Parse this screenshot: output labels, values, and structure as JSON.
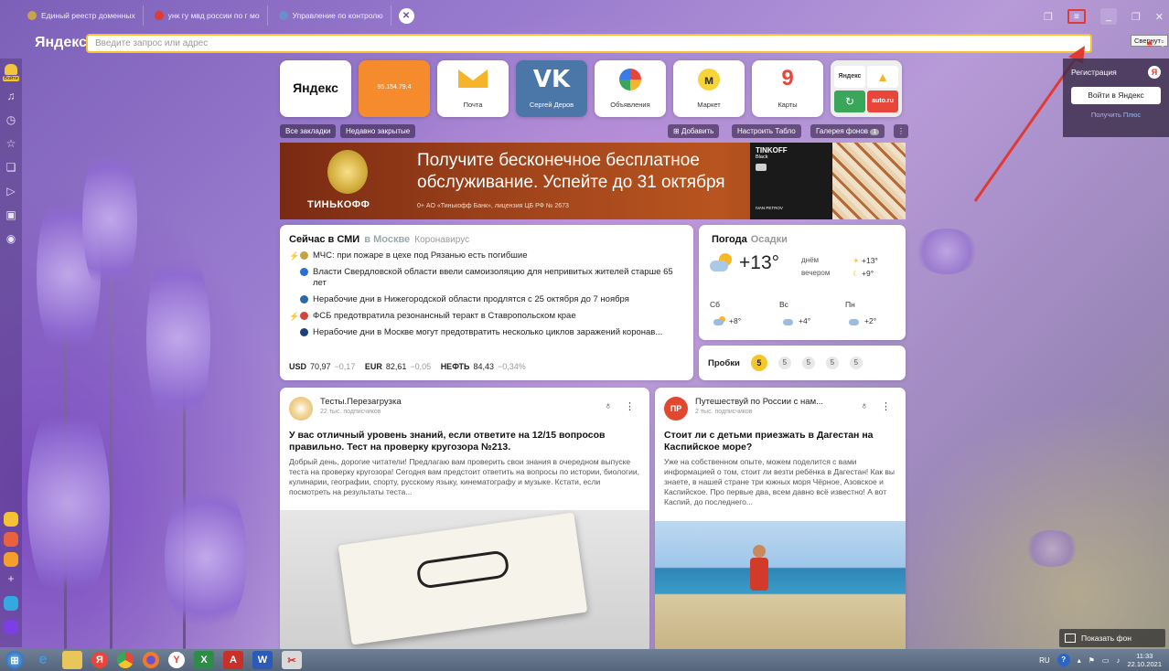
{
  "tabs": [
    {
      "label": "Единый реестр доменных",
      "color": "#c9a24a"
    },
    {
      "label": "унк гу мвд россии по г мо",
      "color": "#e03a33"
    },
    {
      "label": "Управление по контролю",
      "color": "#6a8fc9"
    }
  ],
  "window": {
    "tooltip": "Свернуть"
  },
  "addressbar": {
    "brand": "Яндекс",
    "placeholder": "Введите запрос или адрес"
  },
  "sidebar": {
    "login_label": "Войти"
  },
  "tiles": [
    {
      "label": "Яндекс"
    },
    {
      "label": "95.154.79.4"
    },
    {
      "label": "Почта"
    },
    {
      "label": "Сергей Деров"
    },
    {
      "label": "Объявления"
    },
    {
      "label": "Маркет"
    },
    {
      "label": "Карты"
    },
    {
      "label": "Яндекс",
      "label2": "auto.ru"
    }
  ],
  "bookmarks": {
    "all": "Все закладки",
    "recent": "Недавно закрытые",
    "add": "Добавить",
    "configure": "Настроить Табло",
    "gallery": "Галерея фонов",
    "gallery_count": "1"
  },
  "banner": {
    "text": "Получите бесконечное бесплатное обслуживание. Успейте до 31 октября",
    "logo": "ТИНЬКОФФ",
    "legal": "0+  АО «Тинькофф Банк», лицензия ЦБ РФ № 2673",
    "card_brand": "TINKOFF",
    "card_sub": "Black",
    "card_name": "IVAN PETROV"
  },
  "news": {
    "title": "Сейчас в СМИ",
    "region": "в Москве",
    "topic": "Коронавирус",
    "items": [
      {
        "text": "МЧС: при пожаре в цехе под Рязанью есть погибшие",
        "icon_color": "#c8a040",
        "hot": true
      },
      {
        "text": "Власти Свердловской области ввели самоизоляцию для непривитых жителей старше 65 лет",
        "icon_color": "#2a6fd6",
        "hot": false
      },
      {
        "text": "Нерабочие дни в Нижегородской области продлятся с 25 октября до 7 ноября",
        "icon_color": "#2b6aa8",
        "hot": false
      },
      {
        "text": "ФСБ предотвратила резонансный теракт в Ставропольском крае",
        "icon_color": "#d0463a",
        "hot": true
      },
      {
        "text": "Нерабочие дни в Москве могут предотвратить несколько циклов заражений коронав...",
        "icon_color": "#1e3f7a",
        "hot": false
      }
    ],
    "rates": {
      "usd_label": "USD",
      "usd": "70,97",
      "usd_delta": "−0,17",
      "eur_label": "EUR",
      "eur": "82,61",
      "eur_delta": "−0,05",
      "oil_label": "НЕФТЬ",
      "oil": "84,43",
      "oil_delta": "−0,34%"
    }
  },
  "weather": {
    "title": "Погода",
    "tab": "Осадки",
    "now": "+13°",
    "day_label": "днём",
    "day_temp": "+13°",
    "evening_label": "вечером",
    "evening_temp": "+9°",
    "days": [
      {
        "name": "Сб",
        "temp": "+8°"
      },
      {
        "name": "Вс",
        "temp": "+4°"
      },
      {
        "name": "Пн",
        "temp": "+2°"
      }
    ]
  },
  "traffic": {
    "title": "Пробки",
    "score": "5",
    "forecast": [
      "5",
      "5",
      "5",
      "5"
    ]
  },
  "feed": [
    {
      "channel": "Тесты.Перезагрузка",
      "subs": "22 тыс. подписчиков",
      "title": "У вас отличный уровень знаний, если ответите на 12/15 вопросов правильно. Тест на проверку кругозора №213.",
      "body": "Добрый день, дорогие читатели! Предлагаю вам проверить свои знания в очередном выпуске теста на проверку кругозора! Сегодня вам предстоит ответить на вопросы по истории, биологии, кулинарии, географии, спорту, русскому языку, кинематографу и музыке. Кстати, если посмотреть на результаты теста..."
    },
    {
      "channel": "Путешествуй по России с нам...",
      "subs": "2 тыс. подписчиков",
      "avatar_text": "ПР",
      "title": "Стоит ли с детьми приезжать в Дагестан на Каспийское море?",
      "body": "Уже на собственном опыте, можем поделится с вами информацией о том, стоит ли везти ребёнка в Дагестан! Как вы знаете, в нашей стране три южных моря Чёрное, Азовское и Каспийское. Про первые два, всем давно всё известно! А вот Каспий, до последнего..."
    }
  ],
  "right_panel": {
    "title": "Регистрация",
    "button": "Войти в Яндекс",
    "plus": "Получить Плюс"
  },
  "show_bg": "Показать фон",
  "taskbar": {
    "lang": "RU",
    "time": "11:33",
    "date": "22.10.2021"
  }
}
